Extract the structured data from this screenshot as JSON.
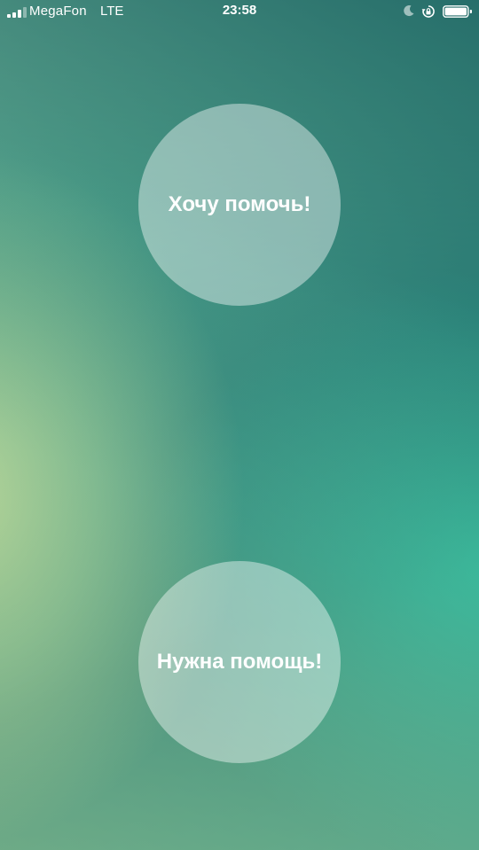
{
  "status_bar": {
    "carrier": "MegaFon",
    "network": "LTE",
    "time": "23:58",
    "signal_bars_filled": 3,
    "signal_bars_total": 4,
    "battery_level": 1.0,
    "icons": [
      "signal-icon",
      "moon-icon",
      "orientation-lock-icon",
      "battery-icon"
    ]
  },
  "main": {
    "offer_help_label": "Хочу помочь!",
    "need_help_label": "Нужна помощь!"
  },
  "colors": {
    "background_top": "#1f6d6b",
    "background_left": "#d3dc98",
    "background_right": "#2dbfa5",
    "button_fill": "rgba(255,255,255,0.42)",
    "text": "#ffffff"
  }
}
